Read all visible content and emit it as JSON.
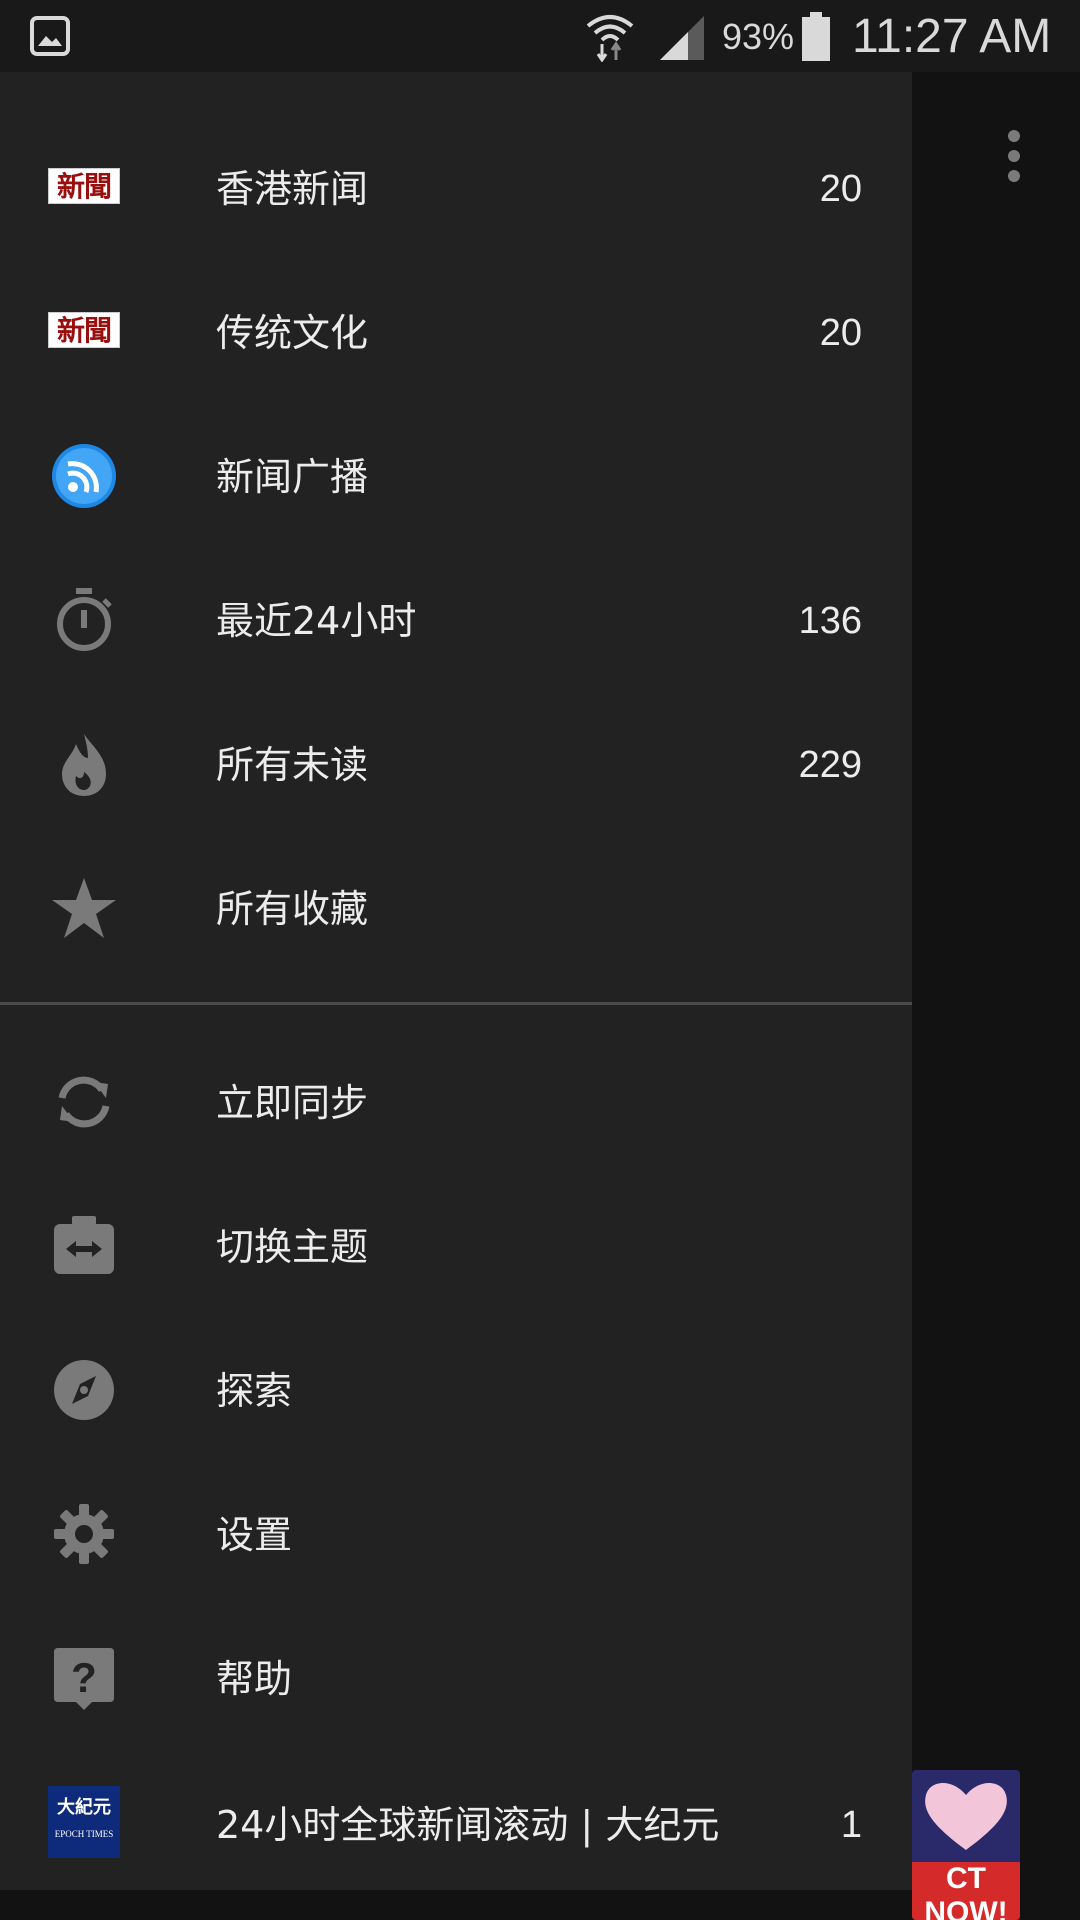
{
  "status_bar": {
    "battery_percent": "93%",
    "time": "11:27 AM",
    "icons": [
      "gallery-icon",
      "wifi-icon",
      "signal-icon",
      "battery-icon"
    ]
  },
  "background_app": {
    "ad_text": "CT NOW!"
  },
  "drawer": {
    "feeds": [
      {
        "icon": "news-badge",
        "badge_text": "新聞",
        "label": "香港新闻",
        "count": "20"
      },
      {
        "icon": "news-badge",
        "badge_text": "新聞",
        "label": "传统文化",
        "count": "20"
      },
      {
        "icon": "rss-icon",
        "label": "新闻广播",
        "count": ""
      },
      {
        "icon": "stopwatch-icon",
        "label": "最近24小时",
        "count": "136"
      },
      {
        "icon": "flame-icon",
        "label": "所有未读",
        "count": "229"
      },
      {
        "icon": "star-icon",
        "label": "所有收藏",
        "count": ""
      }
    ],
    "actions": [
      {
        "icon": "sync-icon",
        "label": "立即同步"
      },
      {
        "icon": "switch-theme-icon",
        "label": "切换主题"
      },
      {
        "icon": "compass-icon",
        "label": "探索"
      },
      {
        "icon": "settings-gear-icon",
        "label": "设置"
      },
      {
        "icon": "help-icon",
        "label": "帮助"
      }
    ],
    "bottom_feed": {
      "icon": "epoch-times-logo",
      "logo_cn": "大紀元",
      "logo_en": "EPOCH TIMES",
      "label": "24小时全球新闻滚动 | 大纪元",
      "count": "1"
    }
  },
  "colors": {
    "drawer_bg": "#222222",
    "status_bar_bg": "#191919",
    "text": "#ececec",
    "icon_gray": "#7a7a7a",
    "rss_blue": "#1e88e5",
    "news_red": "#9a0e0e",
    "epoch_blue": "#0e2a7a"
  }
}
